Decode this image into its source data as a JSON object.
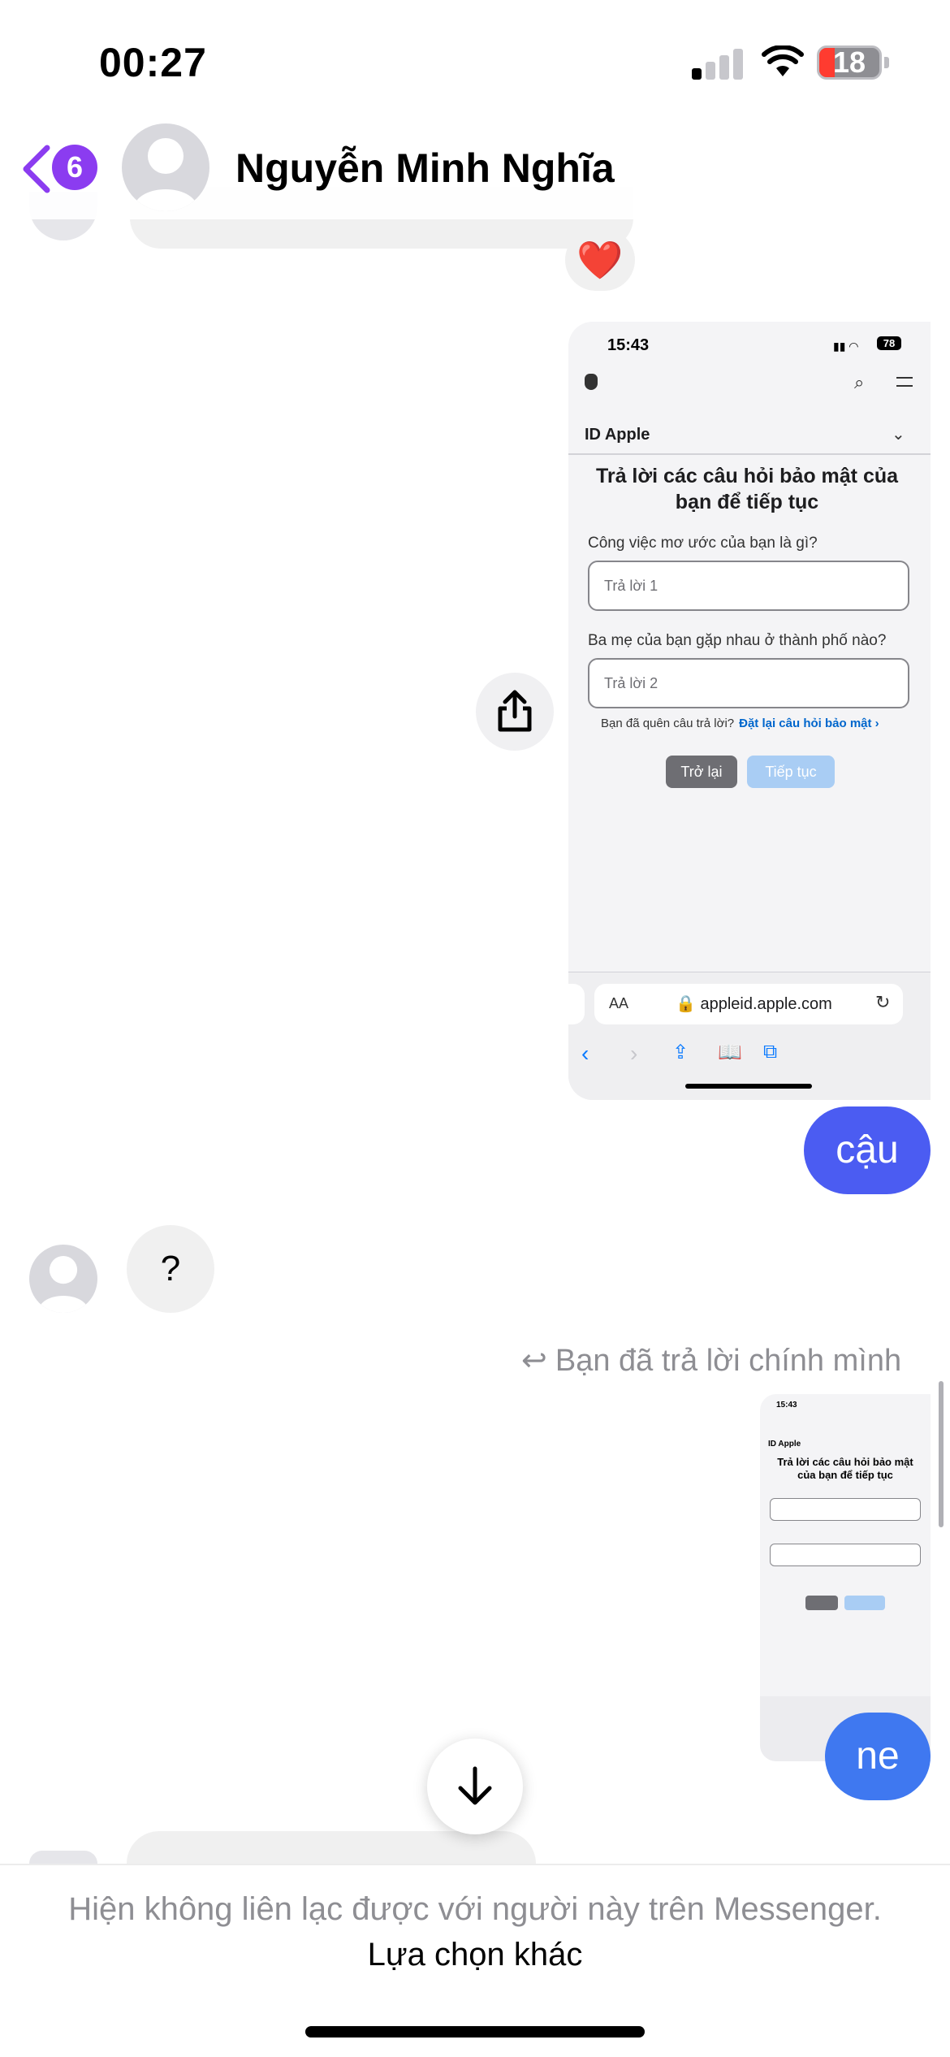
{
  "status_bar": {
    "time": "00:27",
    "battery": "18"
  },
  "header": {
    "unread_count": "6",
    "contact_name": "Nguyễn Minh Nghĩa"
  },
  "messages": {
    "reaction": "❤️",
    "screenshot": {
      "time": "15:43",
      "battery": "78",
      "nav_title": "ID Apple",
      "heading": "Trả lời các câu hỏi bảo mật của bạn để tiếp tục",
      "question_1": "Công việc mơ ước của bạn là gì?",
      "answer_1_placeholder": "Trả lời 1",
      "question_2": "Ba mẹ của bạn gặp nhau ở thành phố nào?",
      "answer_2_placeholder": "Trả lời 2",
      "forgot_text": "Bạn đã quên câu trả lời?",
      "reset_link": "Đặt lại câu hỏi bảo mật ›",
      "back_button": "Trở lại",
      "continue_button": "Tiếp tục",
      "text_size": "AA",
      "url": "appleid.apple.com"
    },
    "outgoing_1": "cậu",
    "incoming_1": "?",
    "reply_note": "Bạn đã trả lời chính mình",
    "thumb_time": "15:43",
    "thumb_title": "ID Apple",
    "outgoing_2": "ne"
  },
  "footer": {
    "notice": "Hiện không liên lạc được với người này trên Messenger.",
    "link": "Lựa chọn khác"
  },
  "colors": {
    "accent_purple": "#8b3cf0",
    "outgoing_bubble": "#4b5cf2",
    "incoming_bubble": "#f0f0f0"
  }
}
